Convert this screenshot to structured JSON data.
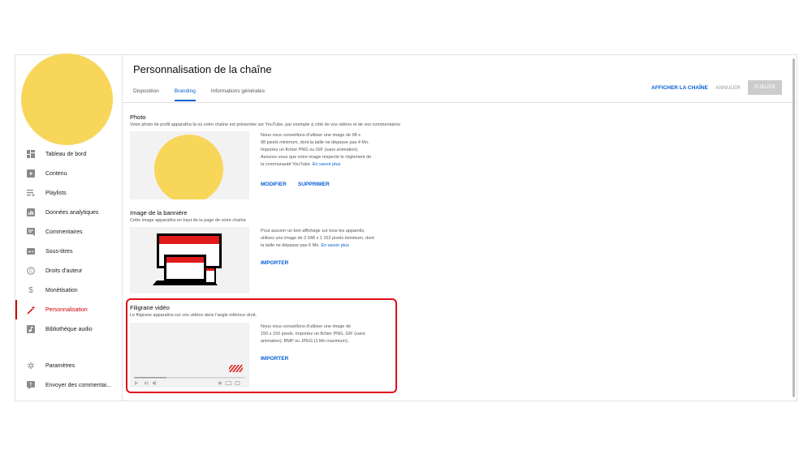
{
  "sidebar": {
    "items": [
      {
        "label": "Tableau de bord",
        "icon": "dashboard-icon"
      },
      {
        "label": "Contenu",
        "icon": "content-icon"
      },
      {
        "label": "Playlists",
        "icon": "playlist-icon"
      },
      {
        "label": "Données analytiques",
        "icon": "analytics-icon"
      },
      {
        "label": "Commentaires",
        "icon": "comments-icon"
      },
      {
        "label": "Sous-titres",
        "icon": "subtitles-icon"
      },
      {
        "label": "Droits d'auteur",
        "icon": "copyright-icon"
      },
      {
        "label": "Monétisation",
        "icon": "dollar-icon"
      },
      {
        "label": "Personnalisation",
        "icon": "magic-wand-icon",
        "active": true
      },
      {
        "label": "Bibliothèque audio",
        "icon": "audio-library-icon"
      }
    ],
    "bottom_items": [
      {
        "label": "Paramètres",
        "icon": "gear-icon"
      },
      {
        "label": "Envoyer des commentai...",
        "icon": "feedback-icon"
      }
    ]
  },
  "header": {
    "title": "Personnalisation de la chaîne",
    "tabs": [
      {
        "label": "Disposition"
      },
      {
        "label": "Branding",
        "active": true
      },
      {
        "label": "Informations générales"
      }
    ],
    "view_channel": "AFFICHER LA CHAÎNE",
    "cancel": "ANNULER",
    "publish": "PUBLIER"
  },
  "photo": {
    "title": "Photo",
    "description": "Votre photo de profil apparaîtra là où votre chaîne est présentée sur YouTube, par exemple à côté de vos vidéos et de vos commentaires",
    "info_lines": [
      "Nous vous conseillons d'utiliser une image de 98 x",
      "98 pixels minimum, dont la taille ne dépasse pas 4 Mo.",
      "Importez un fichier PNG ou GIF (sans animation).",
      "Assurez-vous que votre image respecte le règlement de",
      "la communauté YouTube."
    ],
    "learn_more": "En savoir plus",
    "modify": "MODIFIER",
    "delete": "SUPPRIMER"
  },
  "banner": {
    "title": "Image de la bannière",
    "description": "Cette image apparaîtra en haut de la page de votre chaîne",
    "info_lines": [
      "Pour assurer un bon affichage sur tous les appareils,",
      "utilisez une image de 2 048 x 1 152 pixels minimum, dont",
      "la taille ne dépasse pas 6 Mo."
    ],
    "learn_more": "En savoir plus",
    "import": "IMPORTER"
  },
  "watermark": {
    "title": "Filigrane vidéo",
    "description": "Le filigrane apparaîtra sur vos vidéos dans l'angle inférieur droit.",
    "info_lines": [
      "Nous vous conseillons d'utiliser une image de",
      "150 x 150 pixels. Importez un fichier PNG, GIF (sans",
      "animation), BMP ou JPEG (1 Mo maximum)."
    ],
    "import": "IMPORTER"
  },
  "colors": {
    "accent": "#065fd4",
    "brand_red": "#cc0000",
    "avatar": "#f7d65a",
    "highlight": "#e0101a"
  }
}
